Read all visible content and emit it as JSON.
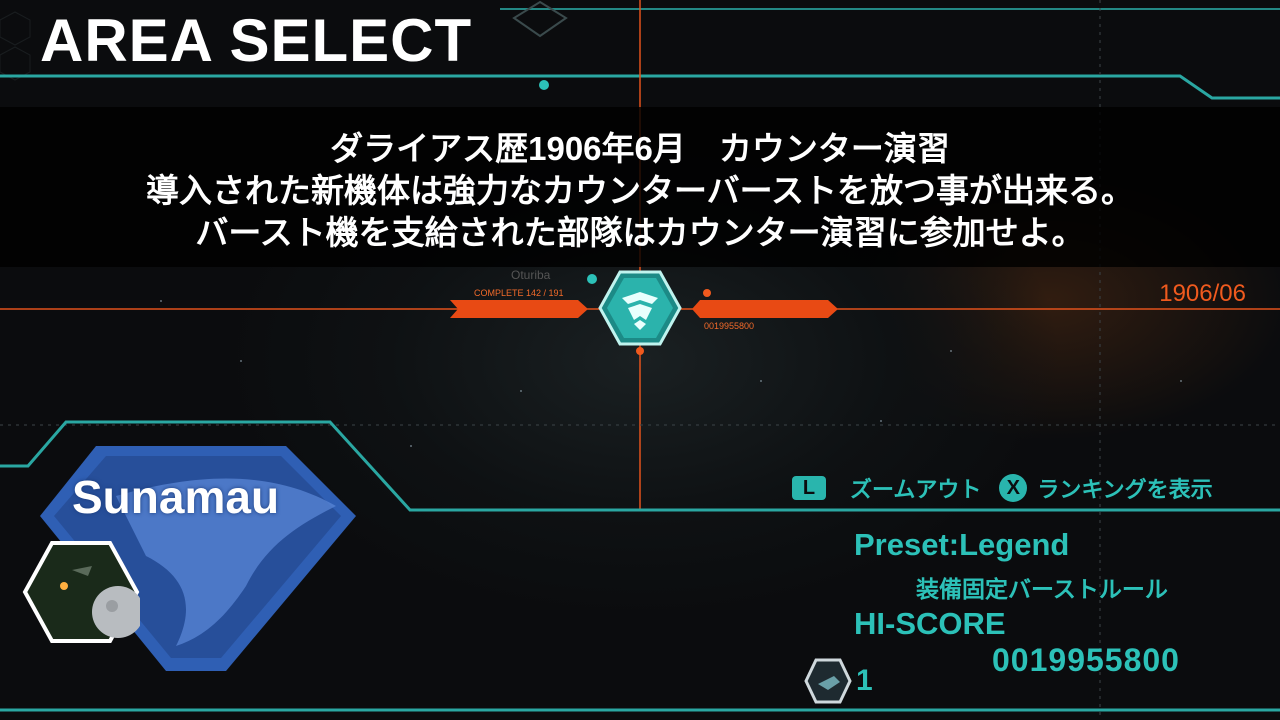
{
  "screen": {
    "title": "AREA SELECT"
  },
  "briefing": {
    "line1": "ダライアス歴1906年6月　カウンター演習",
    "line2": "導入された新機体は強力なカウンターバーストを放つ事が出来る。",
    "line3": "バースト機を支給された部隊はカウンター演習に参加せよ。"
  },
  "map": {
    "date": "1906/06",
    "node_name": "Oturiba",
    "complete_text": "COMPLETE 142 / 191",
    "node_score": "0019955800"
  },
  "controls": {
    "zoom_button": "L",
    "zoom_label": "ズームアウト",
    "ranking_button": "X",
    "ranking_label": "ランキングを表示"
  },
  "area": {
    "name": "Sunamau",
    "preset": "Preset:Legend",
    "rule": "装備固定バーストルール",
    "hiscore_label": "HI-SCORE",
    "hiscore_value": "0019955800",
    "count": "1"
  },
  "colors": {
    "accent_teal": "#2cc1b8",
    "accent_orange": "#f05a1e",
    "area_blue": "#2f5fb4"
  },
  "icons": {
    "emblem": "eagle-emblem-icon",
    "planet": "planet-thumbnail-icon",
    "ship": "ship-thumbnail-icon"
  }
}
